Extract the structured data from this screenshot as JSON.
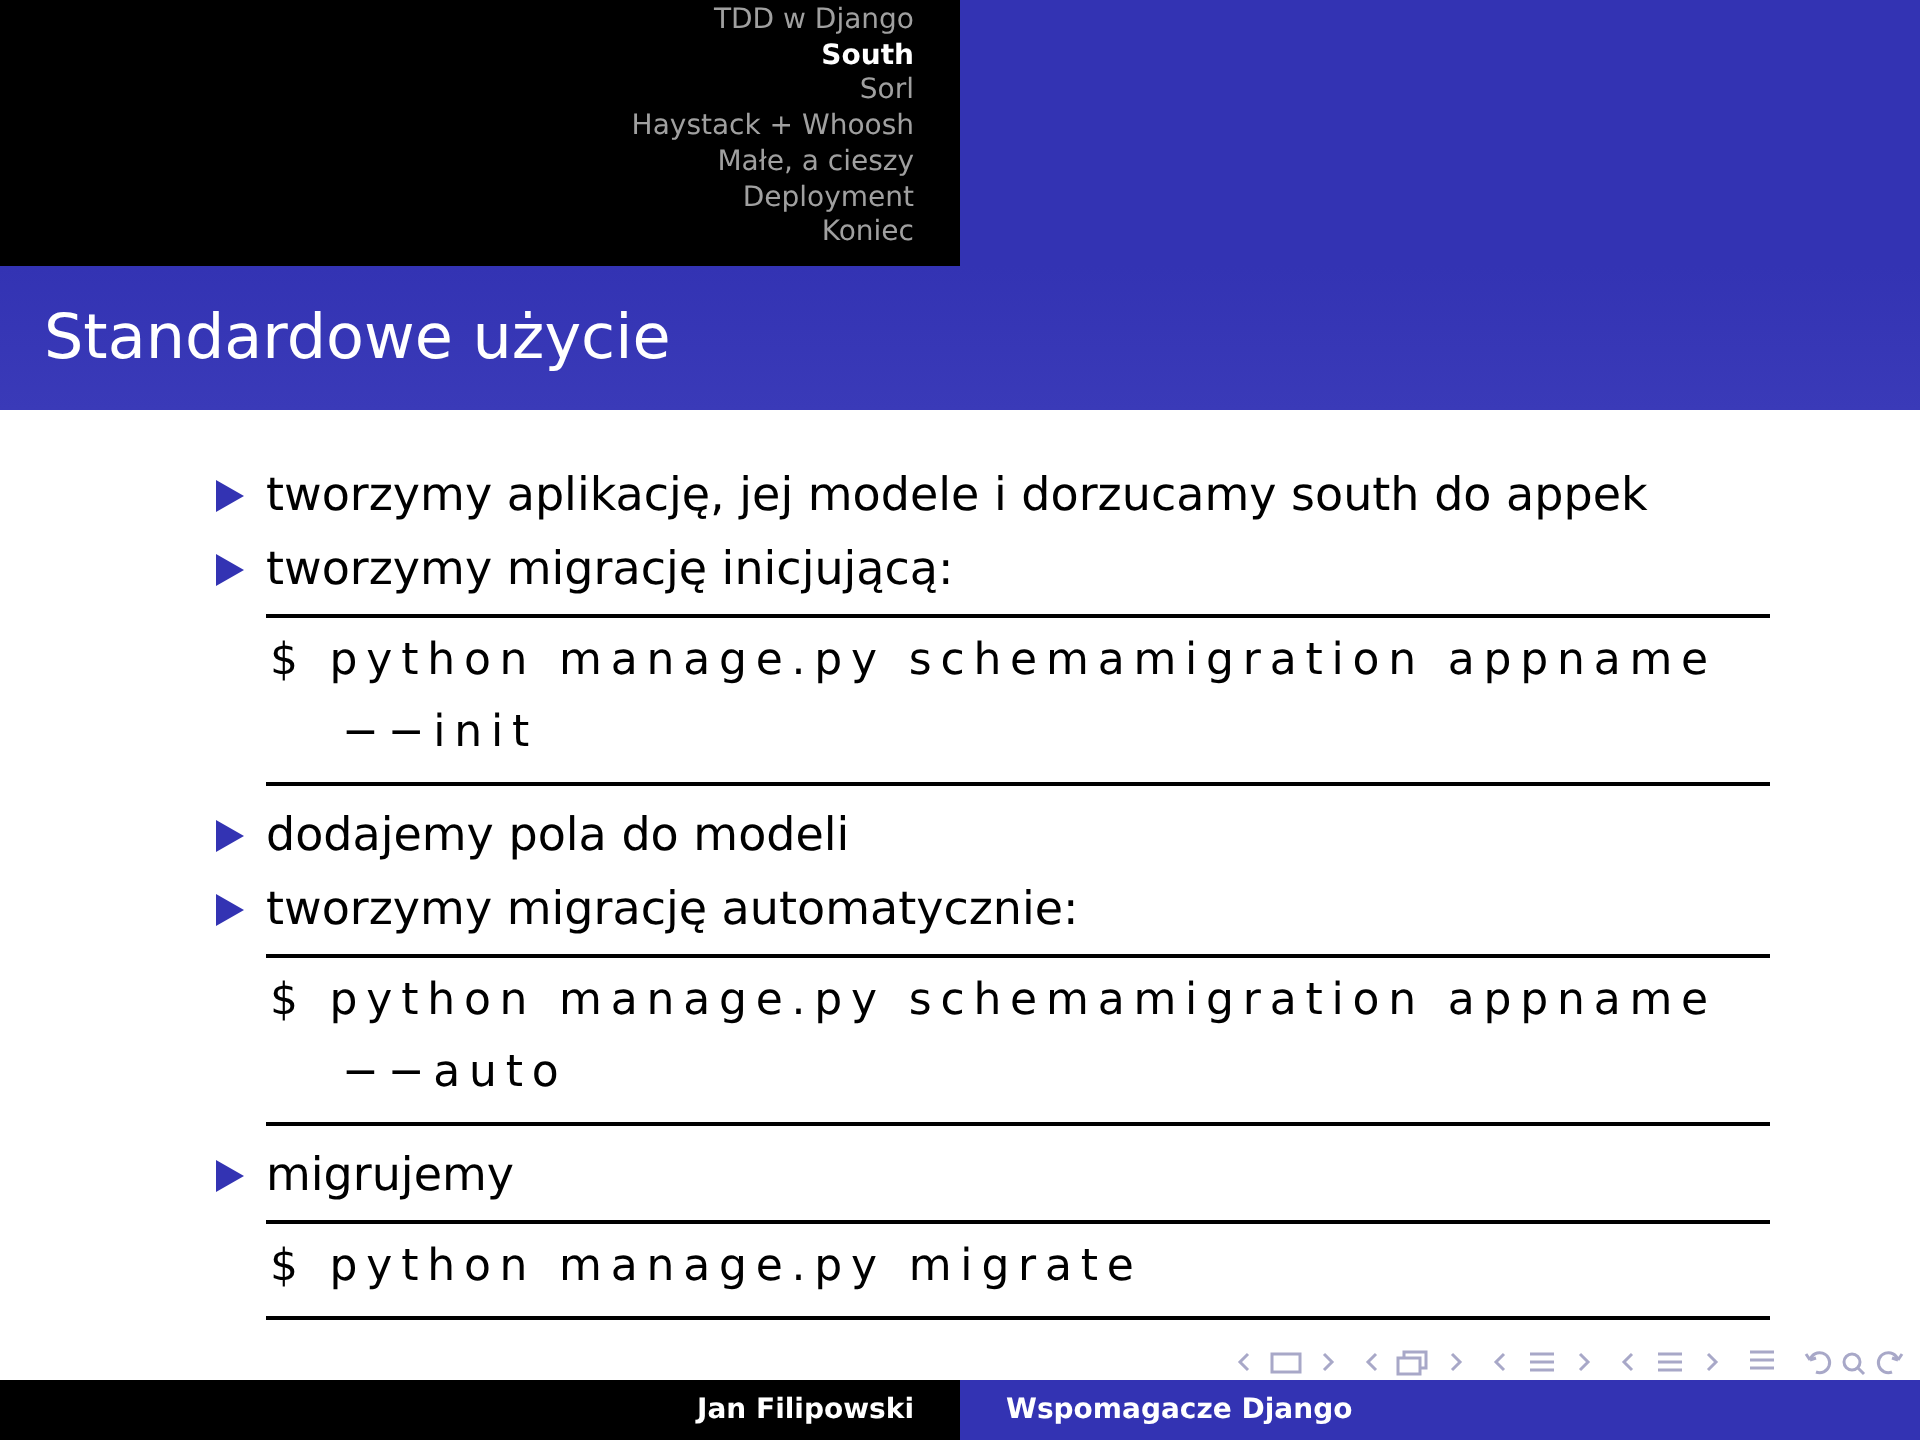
{
  "header": {
    "sections": [
      {
        "label": "TDD w Django",
        "selected": false
      },
      {
        "label": "South",
        "selected": true
      },
      {
        "label": "Sorl",
        "selected": false
      },
      {
        "label": "Haystack + Whoosh",
        "selected": false
      },
      {
        "label": "Małe, a cieszy",
        "selected": false
      },
      {
        "label": "Deployment",
        "selected": false
      },
      {
        "label": "Koniec",
        "selected": false
      }
    ]
  },
  "frame_title": "Standardowe użycie",
  "body": [
    {
      "kind": "bullet",
      "text": "tworzymy aplikację, jej modele i dorzucamy south do appek"
    },
    {
      "kind": "bullet",
      "text": "tworzymy migrację inicjującą:"
    },
    {
      "kind": "code",
      "lines": [
        "$ python manage.py schemamigration appname",
        "−−init"
      ]
    },
    {
      "kind": "bullet",
      "text": "dodajemy pola do modeli"
    },
    {
      "kind": "bullet",
      "text": "tworzymy migrację automatycznie:"
    },
    {
      "kind": "code",
      "lines": [
        "$ python manage.py schemamigration appname",
        "−−auto"
      ]
    },
    {
      "kind": "bullet",
      "text": "migrujemy"
    },
    {
      "kind": "code",
      "lines": [
        "$ python manage.py migrate"
      ]
    }
  ],
  "footer": {
    "author": "Jan Filipowski",
    "title": "Wspomagacze Django"
  }
}
